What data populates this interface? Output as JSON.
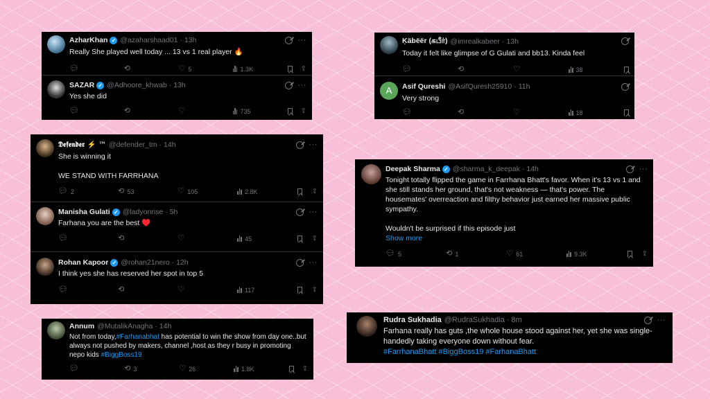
{
  "icons": {
    "reply": "💬",
    "retweet": "⟲",
    "like": "♡",
    "views": "bar-chart",
    "bookmark": "bookmark",
    "share": "⇪",
    "more": "···",
    "grok": "grok-icon",
    "verified": "✓"
  },
  "colors": {
    "background": "#f7bfd8",
    "card": "#000000",
    "text": "#e7e9ea",
    "muted": "#71767b",
    "link": "#1d9bf0",
    "verified": "#1d9bf0"
  },
  "tweets": {
    "azhar": {
      "name": "AzharKhan",
      "handle": "@azaharshaad01",
      "time": "13h",
      "text": "Really She played well today ... 13 vs 1 real player 🔥",
      "replies": "",
      "retweets": "",
      "likes": "5",
      "views": "1.3K"
    },
    "sazar": {
      "name": "SAZAR",
      "handle": "@Adhoore_khwab",
      "time": "13h",
      "text": "Yes she did",
      "replies": "",
      "retweets": "",
      "likes": "",
      "views": "735"
    },
    "kabeer": {
      "name": "Ḳäbëër (கபீர்)",
      "handle": "@imrealkabeer",
      "time": "13h",
      "text": "Today it felt like glimpse of G Gulati and bb13. Kinda feel",
      "replies": "",
      "retweets": "",
      "likes": "",
      "views": "38"
    },
    "asif": {
      "name": "Asif Qureshi",
      "handle": "@AsifQuresh25910",
      "time": "11h",
      "avatar_letter": "A",
      "text": "Very strong",
      "replies": "",
      "retweets": "",
      "likes": "",
      "views": "18"
    },
    "defender": {
      "name": "𝕯𝖊𝖋𝖊𝖓𝖉𝖊𝖗 ⚡ ™",
      "handle": "@defender_tm",
      "time": "14h",
      "text1": "She is winning it",
      "text2": "WE STAND WITH FARRHANA",
      "replies": "2",
      "retweets": "53",
      "likes": "105",
      "views": "2.8K"
    },
    "manisha": {
      "name": "Manisha Gulati",
      "handle": "@ladyonrise",
      "time": "5h",
      "text": "Farhana you are the best ♥️",
      "replies": "",
      "retweets": "",
      "likes": "",
      "views": "45"
    },
    "rohan": {
      "name": "Rohan Kapoor",
      "handle": "@rohan21nero",
      "time": "12h",
      "text": "I think yes she has reserved her spot in top 5",
      "replies": "",
      "retweets": "",
      "likes": "",
      "views": "117"
    },
    "deepak": {
      "name": "Deepak Sharma",
      "handle": "@sharma_k_deepak",
      "time": "14h",
      "text1": "Tonight totally flipped the game in Farrhana Bhatt's favor. When it's 13 vs 1 and she still stands her ground, that's not weakness — that's power. The housemates' overreaction and filthy behavior just earned her massive public sympathy.",
      "text2": "Wouldn't be surprised if this episode just",
      "show_more": "Show more",
      "replies": "5",
      "retweets": "1",
      "likes": "61",
      "views": "9.3K"
    },
    "annum": {
      "name": "Annum",
      "handle": "@MutalikAnagha",
      "time": "14h",
      "text_a": "Not from today,",
      "tag1": "#Farhanabhat",
      "text_b": " has potential to win the show from day one..but  always not pushed by makers, channel ,host as they r busy in promoting nepo kids ",
      "tag2": "#BiggBoss19",
      "replies": "",
      "retweets": "3",
      "likes": "26",
      "views": "1.8K"
    },
    "rudra": {
      "name": "Rudra Sukhadia",
      "handle": "@RudraSukhadia",
      "time": "8m",
      "text": "Farhana really has guts ,the whole house stood against her, yet she was single-handedly taking everyone down without fear.",
      "tags": "#FarrhanaBhatt #BiggBoss19 #FarhanaBhatt"
    }
  }
}
